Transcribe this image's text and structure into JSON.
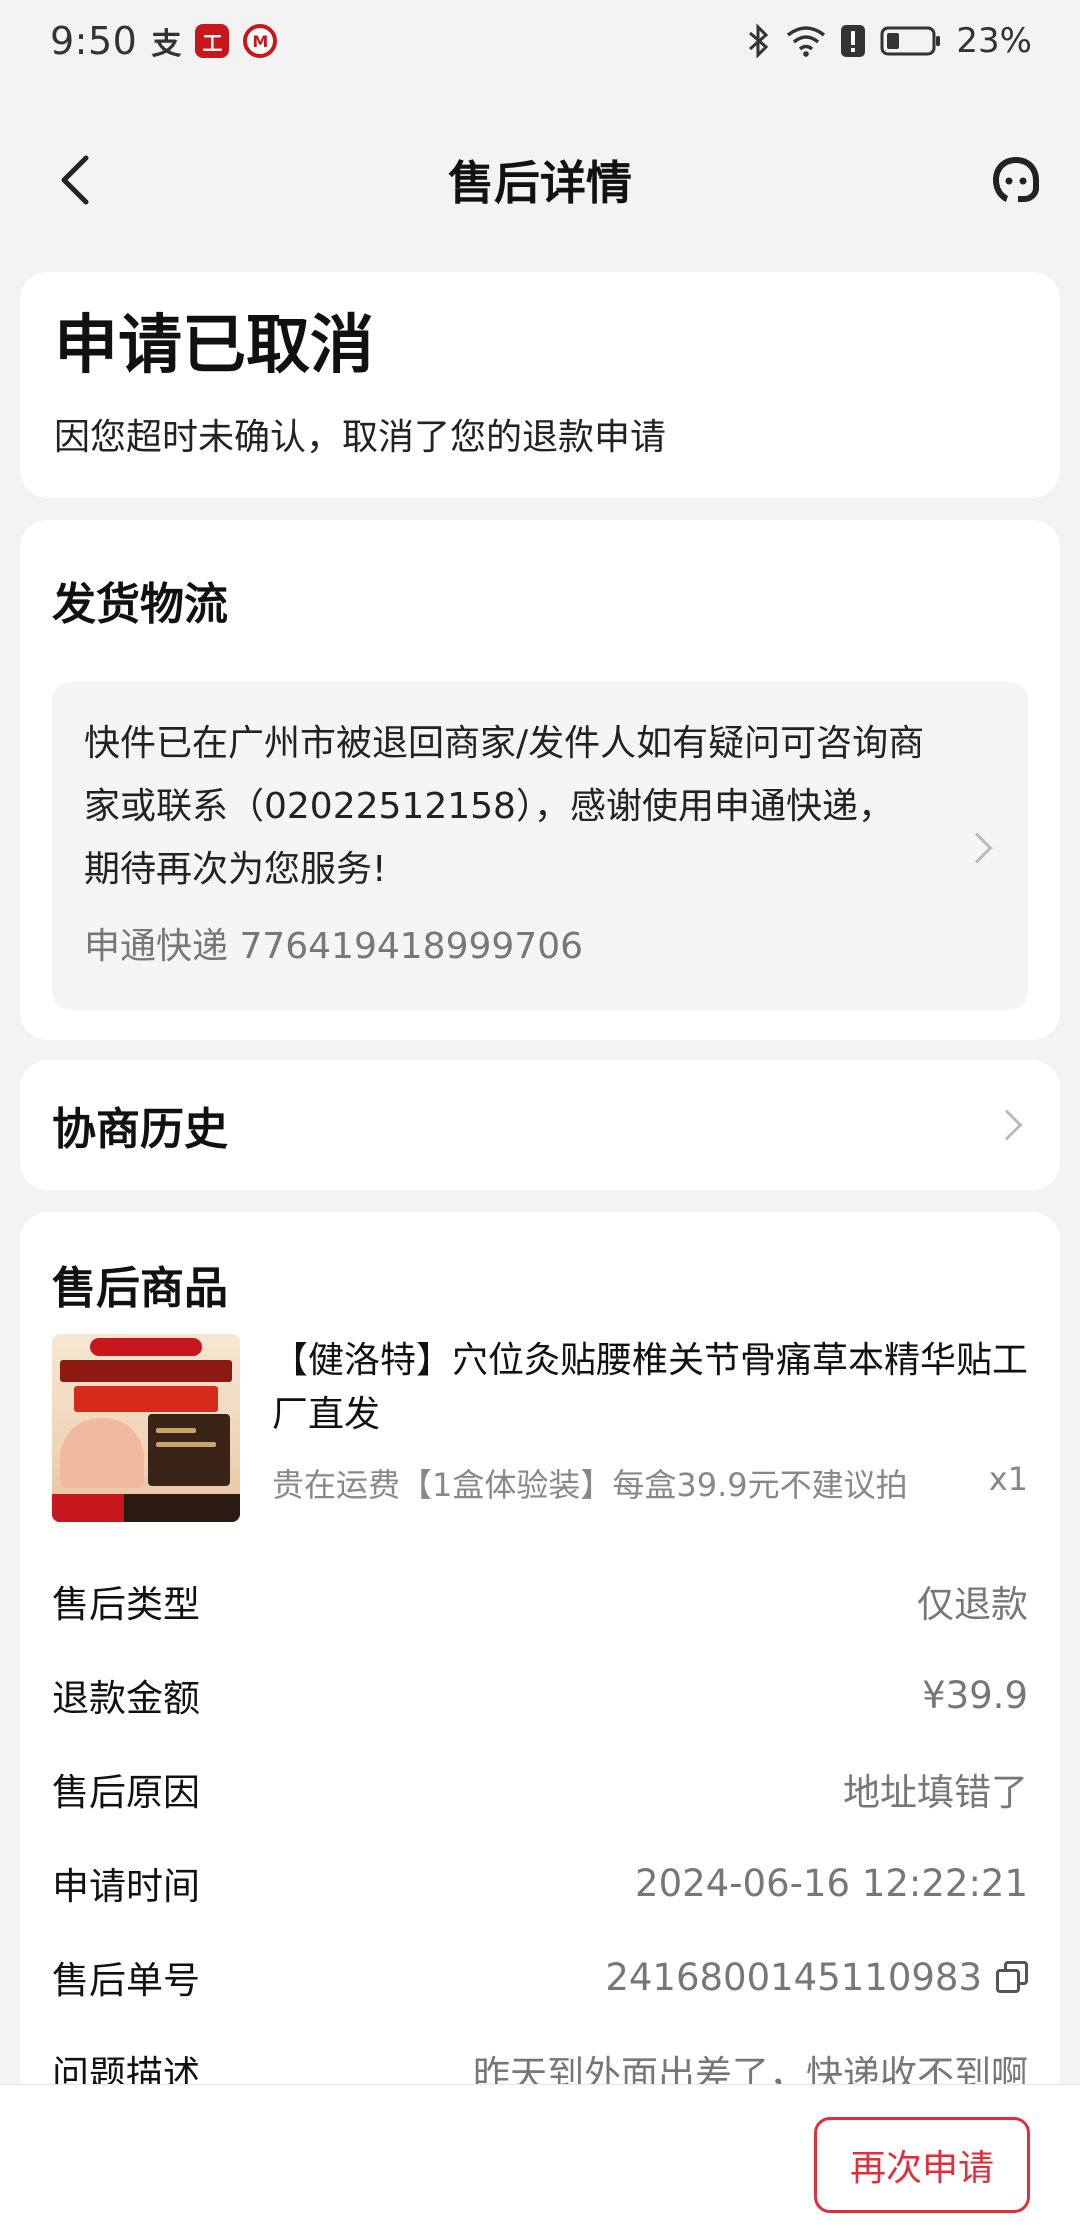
{
  "status_bar": {
    "time": "9:50",
    "battery": "23%",
    "notification_icons": [
      "alipay-icon",
      "bank-icon",
      "cmb-icon"
    ],
    "system_icons": [
      "bluetooth-icon",
      "wifi-icon",
      "alert-icon",
      "battery-icon"
    ]
  },
  "header": {
    "title": "售后详情"
  },
  "status": {
    "title": "申请已取消",
    "description": "因您超时未确认，取消了您的退款申请"
  },
  "logistics": {
    "section_title": "发货物流",
    "message": "快件已在广州市被退回商家/发件人如有疑问可咨询商家或联系（02022512158），感谢使用申通快递，期待再次为您服务!",
    "tracking": "申通快递 776419418999706"
  },
  "history": {
    "title": "协商历史"
  },
  "goods": {
    "section_title": "售后商品",
    "product_name": "【健洛特】穴位灸贴腰椎关节骨痛草本精华贴工厂直发",
    "product_spec": "贵在运费【1盒体验装】每盒39.9元不建议拍",
    "quantity": "x1"
  },
  "details": [
    {
      "label": "售后类型",
      "value": "仅退款"
    },
    {
      "label": "退款金额",
      "value": "¥39.9"
    },
    {
      "label": "售后原因",
      "value": "地址填错了"
    },
    {
      "label": "申请时间",
      "value": "2024-06-16 12:22:21"
    },
    {
      "label": "售后单号",
      "value": "2416800145110983"
    },
    {
      "label": "问题描述",
      "value": "昨天到外面出差了，快递收不到啊"
    }
  ],
  "actions": {
    "reapply_label": "再次申请"
  },
  "colors": {
    "accent": "#e02e3c",
    "background": "#f3f3f3",
    "card": "#ffffff"
  }
}
